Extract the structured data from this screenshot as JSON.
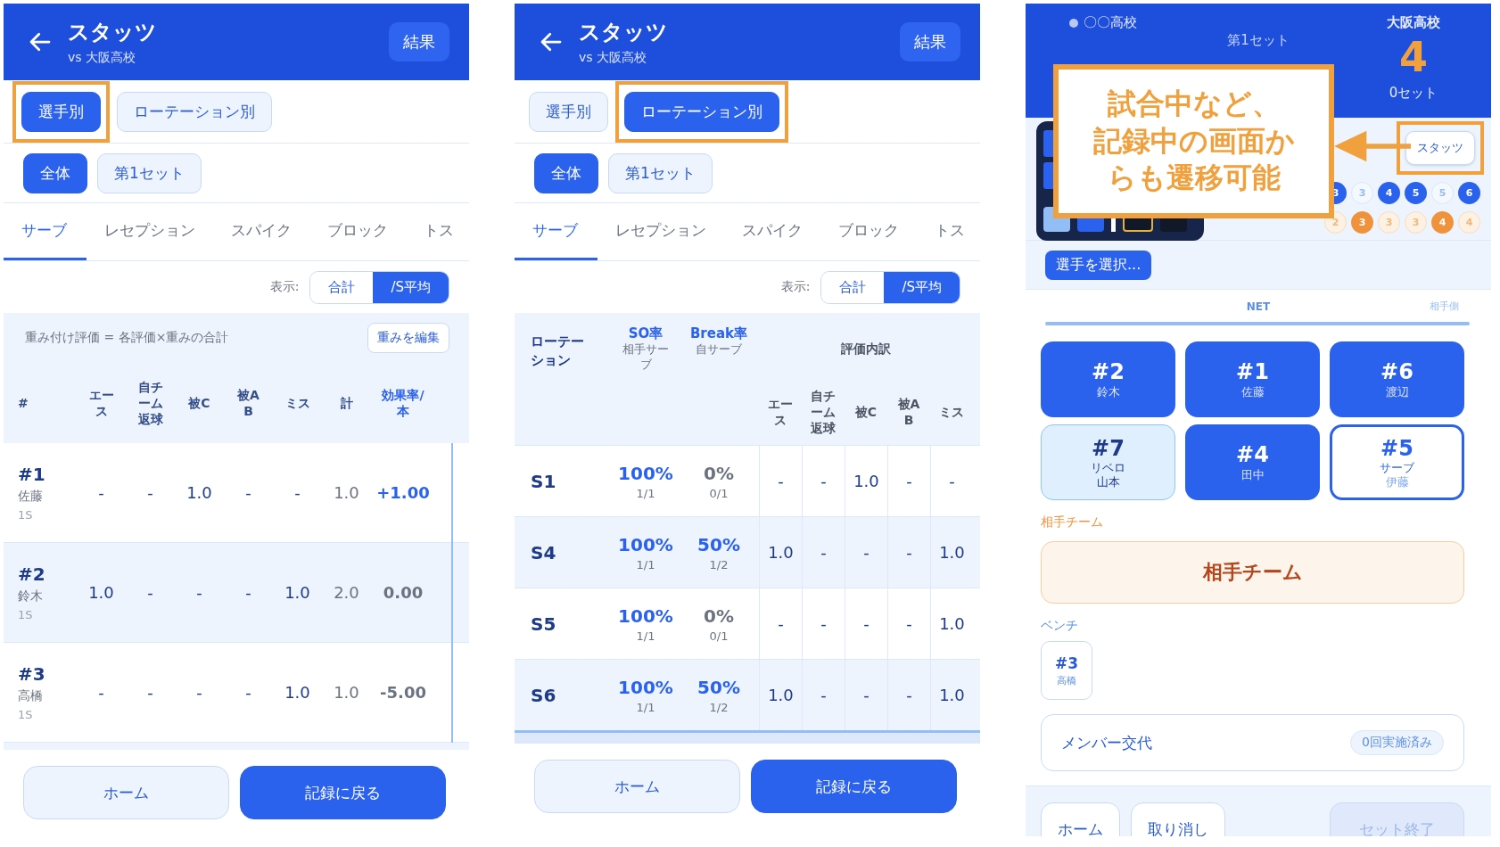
{
  "screens": [
    {
      "kind": "players",
      "header": {
        "title": "スタッツ",
        "subtitle": "vs 大阪高校",
        "action": "結果"
      },
      "modes": [
        {
          "label": "選手別",
          "selected": true,
          "highlighted": true
        },
        {
          "label": "ローテーション別",
          "selected": false,
          "highlighted": false
        }
      ],
      "sets": [
        {
          "label": "全体",
          "selected": true
        },
        {
          "label": "第1セット",
          "selected": false
        }
      ],
      "tabs": [
        {
          "label": "サーブ",
          "selected": true
        },
        {
          "label": "レセプション",
          "selected": false
        },
        {
          "label": "スパイク",
          "selected": false
        },
        {
          "label": "ブロック",
          "selected": false
        },
        {
          "label": "トス",
          "selected": false
        }
      ],
      "display": {
        "label": "表示:",
        "options": [
          {
            "label": "合計",
            "selected": false
          },
          {
            "label": "/S平均",
            "selected": true
          }
        ]
      },
      "note": "重み付け評価 = 各評価×重みの合計",
      "note_button": "重みを編集",
      "player_header": "#",
      "columns": [
        "エース",
        "自チーム返球",
        "被C",
        "被AB",
        "ミス",
        "計",
        "効果率/本"
      ],
      "rows": [
        {
          "number": "#1",
          "name": "佐藤",
          "sets": "1S",
          "cells": [
            "-",
            "-",
            "1.0",
            "-",
            "-",
            "1.0",
            "+1.00"
          ],
          "rate_positive": true
        },
        {
          "number": "#2",
          "name": "鈴木",
          "sets": "1S",
          "cells": [
            "1.0",
            "-",
            "-",
            "-",
            "1.0",
            "2.0",
            "0.00"
          ],
          "rate_positive": false
        },
        {
          "number": "#3",
          "name": "高橋",
          "sets": "1S",
          "cells": [
            "-",
            "-",
            "-",
            "-",
            "1.0",
            "1.0",
            "-5.00"
          ],
          "rate_positive": false
        }
      ],
      "footer": [
        {
          "label": "ホーム",
          "primary": false
        },
        {
          "label": "記録に戻る",
          "primary": true
        }
      ]
    },
    {
      "kind": "rotations",
      "header": {
        "title": "スタッツ",
        "subtitle": "vs 大阪高校",
        "action": "結果"
      },
      "modes": [
        {
          "label": "選手別",
          "selected": false,
          "highlighted": false
        },
        {
          "label": "ローテーション別",
          "selected": true,
          "highlighted": true
        }
      ],
      "sets": [
        {
          "label": "全体",
          "selected": true
        },
        {
          "label": "第1セット",
          "selected": false
        }
      ],
      "tabs": [
        {
          "label": "サーブ",
          "selected": true
        },
        {
          "label": "レセプション",
          "selected": false
        },
        {
          "label": "スパイク",
          "selected": false
        },
        {
          "label": "ブロック",
          "selected": false
        },
        {
          "label": "トス",
          "selected": false
        }
      ],
      "display": {
        "label": "表示:",
        "options": [
          {
            "label": "合計",
            "selected": false
          },
          {
            "label": "/S平均",
            "selected": true
          }
        ]
      },
      "head": {
        "rotation": "ローテーション",
        "so": "SO率",
        "so_sub": "相手サーブ",
        "brk": "Break率",
        "brk_sub": "自サーブ",
        "breakdown": "評価内訳"
      },
      "columns": [
        "エース",
        "自チーム返球",
        "被C",
        "被AB",
        "ミス"
      ],
      "rows": [
        {
          "rotation": "S1",
          "so": "100%",
          "so_count": "1/1",
          "brk": "0%",
          "brk_count": "0/1",
          "brk_positive": false,
          "cells": [
            "-",
            "-",
            "1.0",
            "-",
            "-"
          ]
        },
        {
          "rotation": "S4",
          "so": "100%",
          "so_count": "1/1",
          "brk": "50%",
          "brk_count": "1/2",
          "brk_positive": true,
          "cells": [
            "1.0",
            "-",
            "-",
            "-",
            "1.0"
          ]
        },
        {
          "rotation": "S5",
          "so": "100%",
          "so_count": "1/1",
          "brk": "0%",
          "brk_count": "0/1",
          "brk_positive": false,
          "cells": [
            "-",
            "-",
            "-",
            "-",
            "1.0"
          ]
        },
        {
          "rotation": "S6",
          "so": "100%",
          "so_count": "1/1",
          "brk": "50%",
          "brk_count": "1/2",
          "brk_positive": true,
          "cells": [
            "1.0",
            "-",
            "-",
            "-",
            "1.0"
          ]
        }
      ],
      "footer": [
        {
          "label": "ホーム",
          "primary": false
        },
        {
          "label": "記録に戻る",
          "primary": true
        }
      ]
    },
    {
      "kind": "recording",
      "scoreboard": {
        "home": {
          "name": "〇〇高校",
          "serving": true
        },
        "set_label": "第1セット",
        "away": {
          "name": "大阪高校",
          "score": "4",
          "sets": "0セット"
        }
      },
      "stats_button": {
        "label": "スタッツ",
        "highlighted": true
      },
      "rally_home": [
        {
          "n": "3",
          "won": true
        },
        {
          "n": "3",
          "won": false
        },
        {
          "n": "4",
          "won": true
        },
        {
          "n": "5",
          "won": true
        },
        {
          "n": "5",
          "won": false
        },
        {
          "n": "6",
          "won": true
        }
      ],
      "rally_away": [
        {
          "n": "2",
          "won": false
        },
        {
          "n": "3",
          "won": true
        },
        {
          "n": "3",
          "won": false
        },
        {
          "n": "3",
          "won": false
        },
        {
          "n": "4",
          "won": true
        },
        {
          "n": "4",
          "won": false
        }
      ],
      "select_button": "選手を選択...",
      "net": {
        "label": "NET",
        "side_label": "相手側"
      },
      "players": [
        {
          "number": "#2",
          "name": "鈴木",
          "kind": "regular"
        },
        {
          "number": "#1",
          "name": "佐藤",
          "kind": "regular"
        },
        {
          "number": "#6",
          "name": "渡辺",
          "kind": "regular"
        },
        {
          "number": "#7",
          "role": "リベロ",
          "name": "山本",
          "kind": "libero"
        },
        {
          "number": "#4",
          "name": "田中",
          "kind": "regular"
        },
        {
          "number": "#5",
          "role": "サーブ",
          "name": "伊藤",
          "kind": "server"
        }
      ],
      "opponent": {
        "label": "相手チーム",
        "button": "相手チーム"
      },
      "bench": {
        "label": "ベンチ",
        "players": [
          {
            "number": "#3",
            "name": "高橋"
          }
        ]
      },
      "substitution": {
        "label": "メンバー交代",
        "badge": "0回実施済み"
      },
      "bottom_buttons": [
        {
          "label": "ホーム",
          "disabled": false
        },
        {
          "label": "取り消し",
          "disabled": false
        },
        {
          "label": "セット終了",
          "disabled": true
        }
      ],
      "callout": {
        "lines": [
          "試合中など、",
          "記録中の画面か",
          "らも遷移可能"
        ]
      }
    }
  ]
}
